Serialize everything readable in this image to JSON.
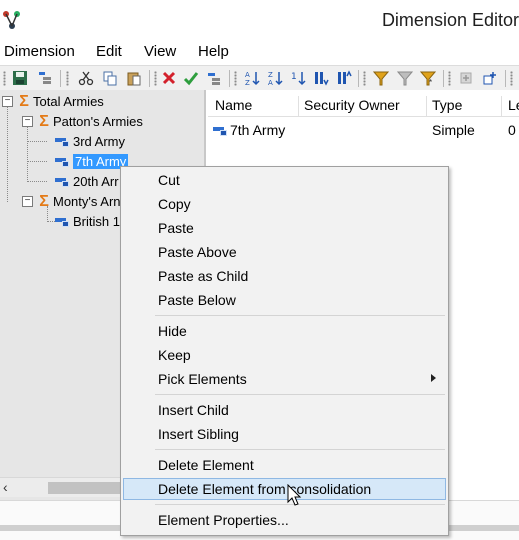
{
  "window": {
    "title": "Dimension Editor"
  },
  "menu": {
    "items": [
      "Dimension",
      "Edit",
      "View",
      "Help"
    ]
  },
  "toolbar": {
    "icons": [
      "save-icon",
      "grid-icon",
      "cut-icon",
      "copy-icon",
      "paste-icon",
      "delete-icon",
      "check-icon",
      "sort-az-icon",
      "sort-za-icon",
      "sort-hierarchy-icon",
      "sort-down-icon",
      "sort-up-icon",
      "filter-icon",
      "filter-clear-icon",
      "filter-star-icon",
      "insert-icon",
      "add-icon"
    ]
  },
  "tree": {
    "items": [
      {
        "label": "Total Armies",
        "type": "consolidated"
      },
      {
        "label": "Patton's Armies",
        "type": "consolidated"
      },
      {
        "label": "3rd Army",
        "type": "simple"
      },
      {
        "label": "7th Army",
        "type": "simple",
        "selected": true
      },
      {
        "label": "20th Arr",
        "type": "simple"
      },
      {
        "label": "Monty's Arn",
        "type": "consolidated"
      },
      {
        "label": "British 1",
        "type": "simple"
      }
    ]
  },
  "grid": {
    "columns": [
      "Name",
      "Security Owner",
      "Type",
      "Le"
    ],
    "rows": [
      {
        "name": "7th Army",
        "security_owner": "",
        "type": "Simple",
        "level": "0"
      }
    ]
  },
  "context_menu": {
    "items": [
      {
        "label": "Cut"
      },
      {
        "label": "Copy"
      },
      {
        "label": "Paste"
      },
      {
        "label": "Paste Above"
      },
      {
        "label": "Paste as Child"
      },
      {
        "label": "Paste Below"
      },
      {
        "label": "Hide"
      },
      {
        "label": "Keep"
      },
      {
        "label": "Pick Elements",
        "submenu": true
      },
      {
        "label": "Insert Child"
      },
      {
        "label": "Insert Sibling"
      },
      {
        "label": "Delete Element"
      },
      {
        "label": "Delete Element from consolidation",
        "hovered": true
      },
      {
        "label": "Element Properties..."
      }
    ]
  },
  "colors": {
    "selection": "#3399ff",
    "consolidated_icon": "#e47a16",
    "menu_hover": "#d6e8f8",
    "menu_hover_border": "#8fb8e3"
  }
}
